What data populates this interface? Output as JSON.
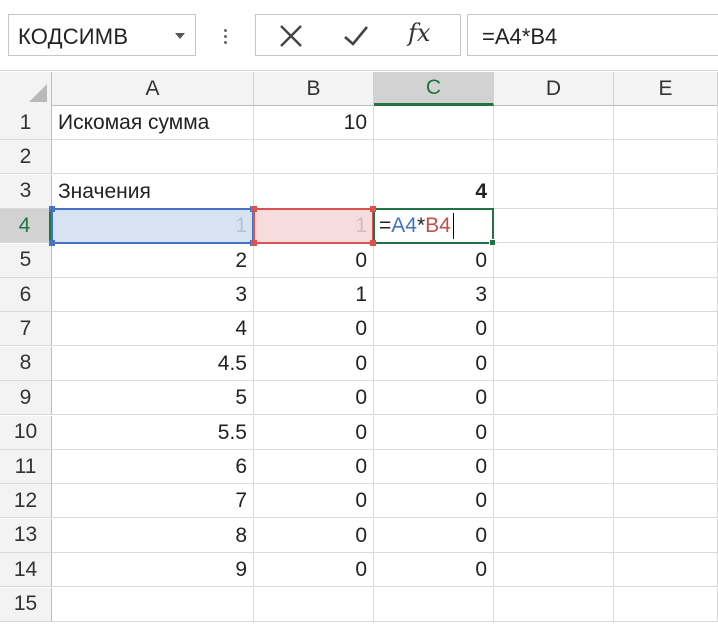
{
  "formula_bar": {
    "name_box": "КОДСИМВ",
    "name_box_arrow_icon": "chevron-down-icon",
    "cancel_icon": "close-icon",
    "enter_icon": "check-icon",
    "function_label": "fx",
    "formula": "=A4*B4"
  },
  "columns": [
    "A",
    "B",
    "C",
    "D",
    "E"
  ],
  "active_column": "C",
  "active_row": "4",
  "rows": [
    {
      "num": "1",
      "A": "Искомая сумма",
      "B": "10",
      "C": ""
    },
    {
      "num": "2",
      "A": "",
      "B": "",
      "C": ""
    },
    {
      "num": "3",
      "A": "Значения",
      "B": "",
      "C": "4"
    },
    {
      "num": "4",
      "A": "1",
      "B": "1",
      "C": ""
    },
    {
      "num": "5",
      "A": "2",
      "B": "0",
      "C": "0"
    },
    {
      "num": "6",
      "A": "3",
      "B": "1",
      "C": "3"
    },
    {
      "num": "7",
      "A": "4",
      "B": "0",
      "C": "0"
    },
    {
      "num": "8",
      "A": "4.5",
      "B": "0",
      "C": "0"
    },
    {
      "num": "9",
      "A": "5",
      "B": "0",
      "C": "0"
    },
    {
      "num": "10",
      "A": "5.5",
      "B": "0",
      "C": "0"
    },
    {
      "num": "11",
      "A": "6",
      "B": "0",
      "C": "0"
    },
    {
      "num": "12",
      "A": "7",
      "B": "0",
      "C": "0"
    },
    {
      "num": "13",
      "A": "8",
      "B": "0",
      "C": "0"
    },
    {
      "num": "14",
      "A": "9",
      "B": "0",
      "C": "0"
    },
    {
      "num": "15",
      "A": "",
      "B": "",
      "C": ""
    }
  ],
  "edit_cell": {
    "prefix": "=",
    "ref1": "A4",
    "op": "*",
    "ref2": "B4"
  },
  "colors": {
    "excel_green": "#217346",
    "ref_blue": "#4472c4",
    "ref_red": "#d9534f"
  }
}
